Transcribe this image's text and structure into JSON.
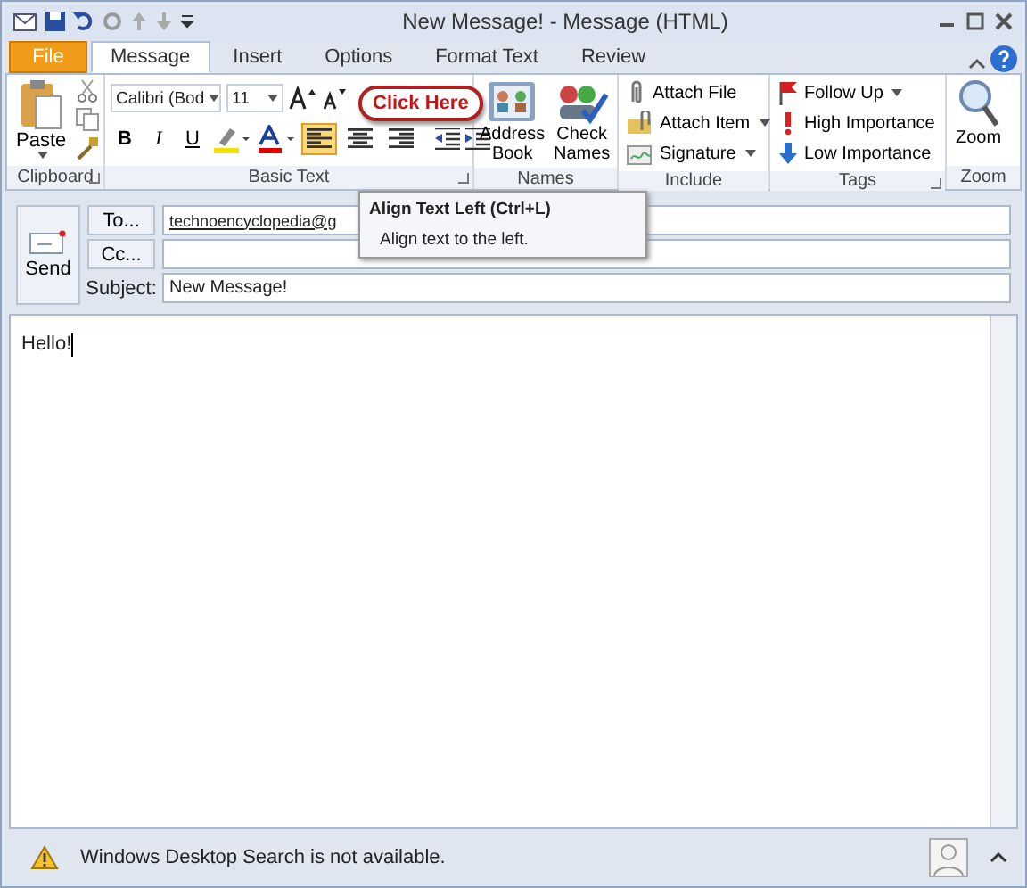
{
  "window": {
    "title": "New Message!  - Message (HTML)"
  },
  "tabs": [
    {
      "label": "File",
      "kind": "file",
      "selected": false
    },
    {
      "label": "Message",
      "kind": "tab",
      "selected": true
    },
    {
      "label": "Insert",
      "kind": "tab",
      "selected": false
    },
    {
      "label": "Options",
      "kind": "tab",
      "selected": false
    },
    {
      "label": "Format Text",
      "kind": "tab",
      "selected": false
    },
    {
      "label": "Review",
      "kind": "tab",
      "selected": false
    }
  ],
  "ribbon": {
    "clipboard": {
      "paste": "Paste",
      "label": "Clipboard"
    },
    "basic_text": {
      "font": "Calibri (Bod",
      "size": "11",
      "bold": "B",
      "italic": "I",
      "underline": "U",
      "align": [
        {
          "kind": "left",
          "selected": true
        },
        {
          "kind": "center",
          "selected": false
        },
        {
          "kind": "right",
          "selected": false
        }
      ],
      "label": "Basic Text"
    },
    "names": {
      "buttons": [
        "Address Book",
        "Check Names"
      ],
      "label": "Names"
    },
    "include": {
      "items": [
        {
          "label": "Attach File",
          "kind": "clip",
          "dropdown": false
        },
        {
          "label": "Attach Item",
          "kind": "item",
          "dropdown": true
        },
        {
          "label": "Signature",
          "kind": "signature",
          "dropdown": true
        }
      ],
      "label": "Include"
    },
    "tags": {
      "items": [
        {
          "label": "Follow Up",
          "kind": "flag",
          "dropdown": true
        },
        {
          "label": "High Importance",
          "kind": "high",
          "dropdown": false
        },
        {
          "label": "Low Importance",
          "kind": "low",
          "dropdown": false
        }
      ],
      "label": "Tags"
    },
    "zoom": {
      "button": "Zoom",
      "label": "Zoom"
    }
  },
  "callout": "Click Here",
  "tooltip": {
    "title": "Align Text Left (Ctrl+L)",
    "text": "Align text to the left."
  },
  "compose": {
    "send": "Send",
    "to_button": "To...",
    "to_value": "technoencyclopedia@g",
    "cc_button": "Cc...",
    "subject_label": "Subject:",
    "subject_value": "New Message!"
  },
  "body": "Hello!",
  "status": "Windows Desktop Search is not available."
}
